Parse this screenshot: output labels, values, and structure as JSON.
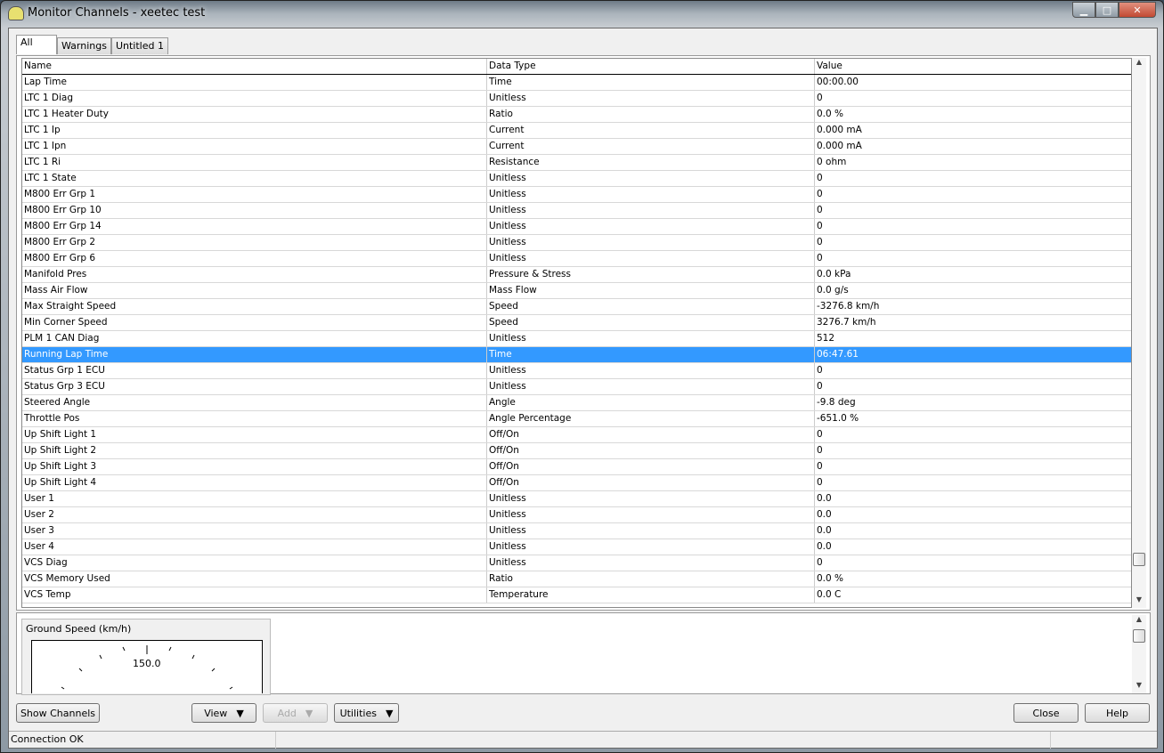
{
  "window": {
    "title": "Monitor Channels - xeetec test"
  },
  "tabs": [
    {
      "label": "All"
    },
    {
      "label": "Warnings"
    },
    {
      "label": "Untitled 1"
    }
  ],
  "table": {
    "columns": [
      "Name",
      "Data Type",
      "Value"
    ],
    "rows": [
      [
        "Lap Time",
        "Time",
        "00:00.00"
      ],
      [
        "LTC 1 Diag",
        "Unitless",
        "0"
      ],
      [
        "LTC 1 Heater Duty",
        "Ratio",
        "0.0 %"
      ],
      [
        "LTC 1 Ip",
        "Current",
        "0.000 mA"
      ],
      [
        "LTC 1 Ipn",
        "Current",
        "0.000 mA"
      ],
      [
        "LTC 1 Ri",
        "Resistance",
        "0 ohm"
      ],
      [
        "LTC 1 State",
        "Unitless",
        "0"
      ],
      [
        "M800 Err Grp 1",
        "Unitless",
        "0"
      ],
      [
        "M800 Err Grp 10",
        "Unitless",
        "0"
      ],
      [
        "M800 Err Grp 14",
        "Unitless",
        "0"
      ],
      [
        "M800 Err Grp 2",
        "Unitless",
        "0"
      ],
      [
        "M800 Err Grp 6",
        "Unitless",
        "0"
      ],
      [
        "Manifold Pres",
        "Pressure & Stress",
        "0.0 kPa"
      ],
      [
        "Mass Air Flow",
        "Mass Flow",
        "0.0 g/s"
      ],
      [
        "Max Straight Speed",
        "Speed",
        "-3276.8 km/h"
      ],
      [
        "Min Corner Speed",
        "Speed",
        "3276.7 km/h"
      ],
      [
        "PLM 1 CAN Diag",
        "Unitless",
        "512"
      ],
      [
        "Running Lap Time",
        "Time",
        "06:47.61"
      ],
      [
        "Status Grp 1 ECU",
        "Unitless",
        "0"
      ],
      [
        "Status Grp 3 ECU",
        "Unitless",
        "0"
      ],
      [
        "Steered Angle",
        "Angle",
        "-9.8 deg"
      ],
      [
        "Throttle Pos",
        "Angle Percentage",
        "-651.0 %"
      ],
      [
        "Up Shift Light 1",
        "Off/On",
        "0"
      ],
      [
        "Up Shift Light 2",
        "Off/On",
        "0"
      ],
      [
        "Up Shift Light 3",
        "Off/On",
        "0"
      ],
      [
        "Up Shift Light 4",
        "Off/On",
        "0"
      ],
      [
        "User 1",
        "Unitless",
        "0.0"
      ],
      [
        "User 2",
        "Unitless",
        "0.0"
      ],
      [
        "User 3",
        "Unitless",
        "0.0"
      ],
      [
        "User 4",
        "Unitless",
        "0.0"
      ],
      [
        "VCS Diag",
        "Unitless",
        "0"
      ],
      [
        "VCS Memory Used",
        "Ratio",
        "0.0 %"
      ],
      [
        "VCS Temp",
        "Temperature",
        "0.0 C"
      ]
    ],
    "selected_row": 17,
    "selection_color": "#3399ff"
  },
  "gauge": {
    "title": "Ground Speed (km/h)",
    "value": "150.0"
  },
  "buttons": {
    "show_channels": "Show Channels",
    "view": "View",
    "add": "Add",
    "utilities": "Utilities",
    "close": "Close",
    "help": "Help"
  },
  "status": {
    "text": "Connection OK"
  }
}
